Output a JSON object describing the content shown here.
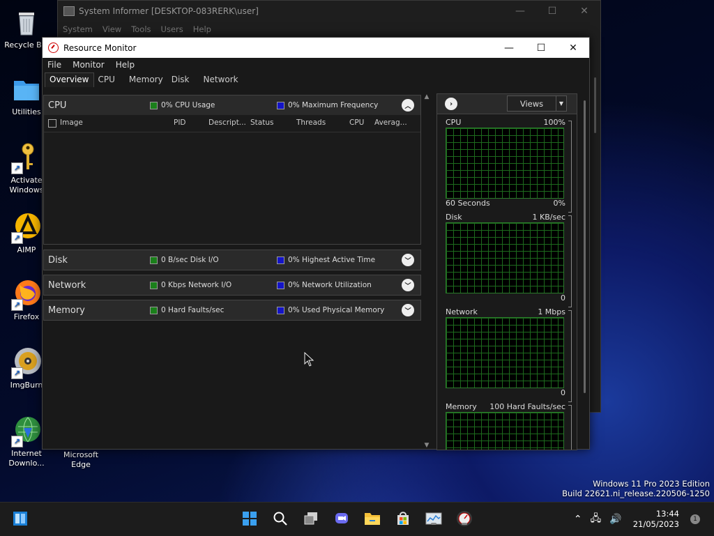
{
  "desktop": {
    "icons": [
      {
        "label": "Recycle Bin",
        "icon": "recycle-bin-icon"
      },
      {
        "label": "Utilities",
        "icon": "folder-icon"
      },
      {
        "label": "Activate Windows",
        "icon": "key-icon"
      },
      {
        "label": "AIMP",
        "icon": "aimp-icon"
      },
      {
        "label": "Firefox",
        "icon": "firefox-icon"
      },
      {
        "label": "ImgBurn",
        "icon": "disc-icon"
      },
      {
        "label": "Internet Downlo...",
        "icon": "idm-icon"
      },
      {
        "label": "Microsoft Edge",
        "icon": "edge-icon"
      }
    ]
  },
  "system_informer": {
    "title": "System Informer [DESKTOP-083RERK\\user]",
    "menu": [
      "System",
      "View",
      "Tools",
      "Users",
      "Help"
    ]
  },
  "resource_monitor": {
    "title": "Resource Monitor",
    "menu": [
      "File",
      "Monitor",
      "Help"
    ],
    "tabs": [
      "Overview",
      "CPU",
      "Memory",
      "Disk",
      "Network"
    ],
    "active_tab": "Overview",
    "panels": {
      "cpu": {
        "title": "CPU",
        "metric1": "0% CPU Usage",
        "metric2": "0% Maximum Frequency",
        "columns": [
          "Image",
          "PID",
          "Descript...",
          "Status",
          "Threads",
          "CPU",
          "Averag..."
        ]
      },
      "disk": {
        "title": "Disk",
        "metric1": "0 B/sec Disk I/O",
        "metric2": "0% Highest Active Time"
      },
      "network": {
        "title": "Network",
        "metric1": "0 Kbps Network I/O",
        "metric2": "0% Network Utilization"
      },
      "memory": {
        "title": "Memory",
        "metric1": "0 Hard Faults/sec",
        "metric2": "0% Used Physical Memory"
      }
    },
    "charts": {
      "views_label": "Views",
      "cpu": {
        "label": "CPU",
        "max": "100%",
        "foot_left": "60 Seconds",
        "foot_right": "0%"
      },
      "disk": {
        "label": "Disk",
        "max": "1 KB/sec",
        "foot_right": "0"
      },
      "network": {
        "label": "Network",
        "max": "1 Mbps",
        "foot_right": "0"
      },
      "memory": {
        "label": "Memory",
        "max": "100 Hard Faults/sec"
      }
    }
  },
  "watermark": {
    "line1": "Windows 11 Pro 2023 Edition",
    "line2": "Build 22621.ni_release.220506-1250"
  },
  "taskbar": {
    "time": "13:44",
    "date": "21/05/2023",
    "notification_count": "1"
  }
}
